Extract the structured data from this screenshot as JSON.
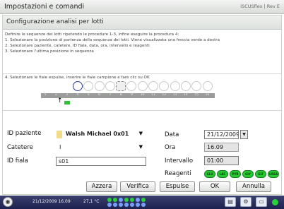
{
  "titlebar": {
    "title": "Impostazioni e comandi",
    "brand": "iSCUSflex | Rev E"
  },
  "header": {
    "title": "Configurazione analisi per lotti"
  },
  "instructions": {
    "intro": "Definire le sequenze dei lotti ripetendo le procedure 1-3, infine eseguire la procedura 4:",
    "step1": "1. Selezionare la posizione di partenza della sequenza dei lotti. Viene visualizzata una freccia verde a destra",
    "step2": "2. Selezionare paziente, catetere, ID fiala, data, ora, intervallo e reagenti",
    "step3": "3. Selezionare l'ultima posizione in sequenza",
    "step4": "4. Selezionare le fiale espulse, inserire le fiale campione e fare clic su OK"
  },
  "rack": {
    "positions": [
      "1",
      "2",
      "3",
      "4",
      "5",
      "6",
      "7",
      "8",
      "9",
      "10",
      "11",
      "12",
      "13",
      "14",
      "15",
      "16"
    ],
    "start_position": "4",
    "target_position": "8"
  },
  "form": {
    "patient_label": "ID paziente",
    "patient_value": "Walsh Michael 0x01",
    "catheter_label": "Catetere",
    "catheter_value": "I",
    "vial_label": "ID fiala",
    "vial_value": "s01",
    "date_label": "Data",
    "date_value": "21/12/2009",
    "time_label": "Ora",
    "time_value": "16.09",
    "interval_label": "Intervallo",
    "interval_value": "01:00",
    "reagents_label": "Reagenti",
    "reagents": [
      "GLU",
      "LAC",
      "PYR",
      "GLY",
      "GLT",
      "UREA"
    ]
  },
  "buttons": {
    "reset": "Azzera",
    "verify": "Verifica",
    "eject": "Espulse",
    "ok": "OK",
    "cancel": "Annulla"
  },
  "taskbar": {
    "datetime": "21/12/2009 16.09",
    "temperature": "27,1 °C"
  },
  "colors": {
    "reagent_green": "#27c832",
    "marker_green": "#2fbf3a",
    "taskbar": "#1d2150",
    "patient_chip": "#f2dc8a"
  }
}
